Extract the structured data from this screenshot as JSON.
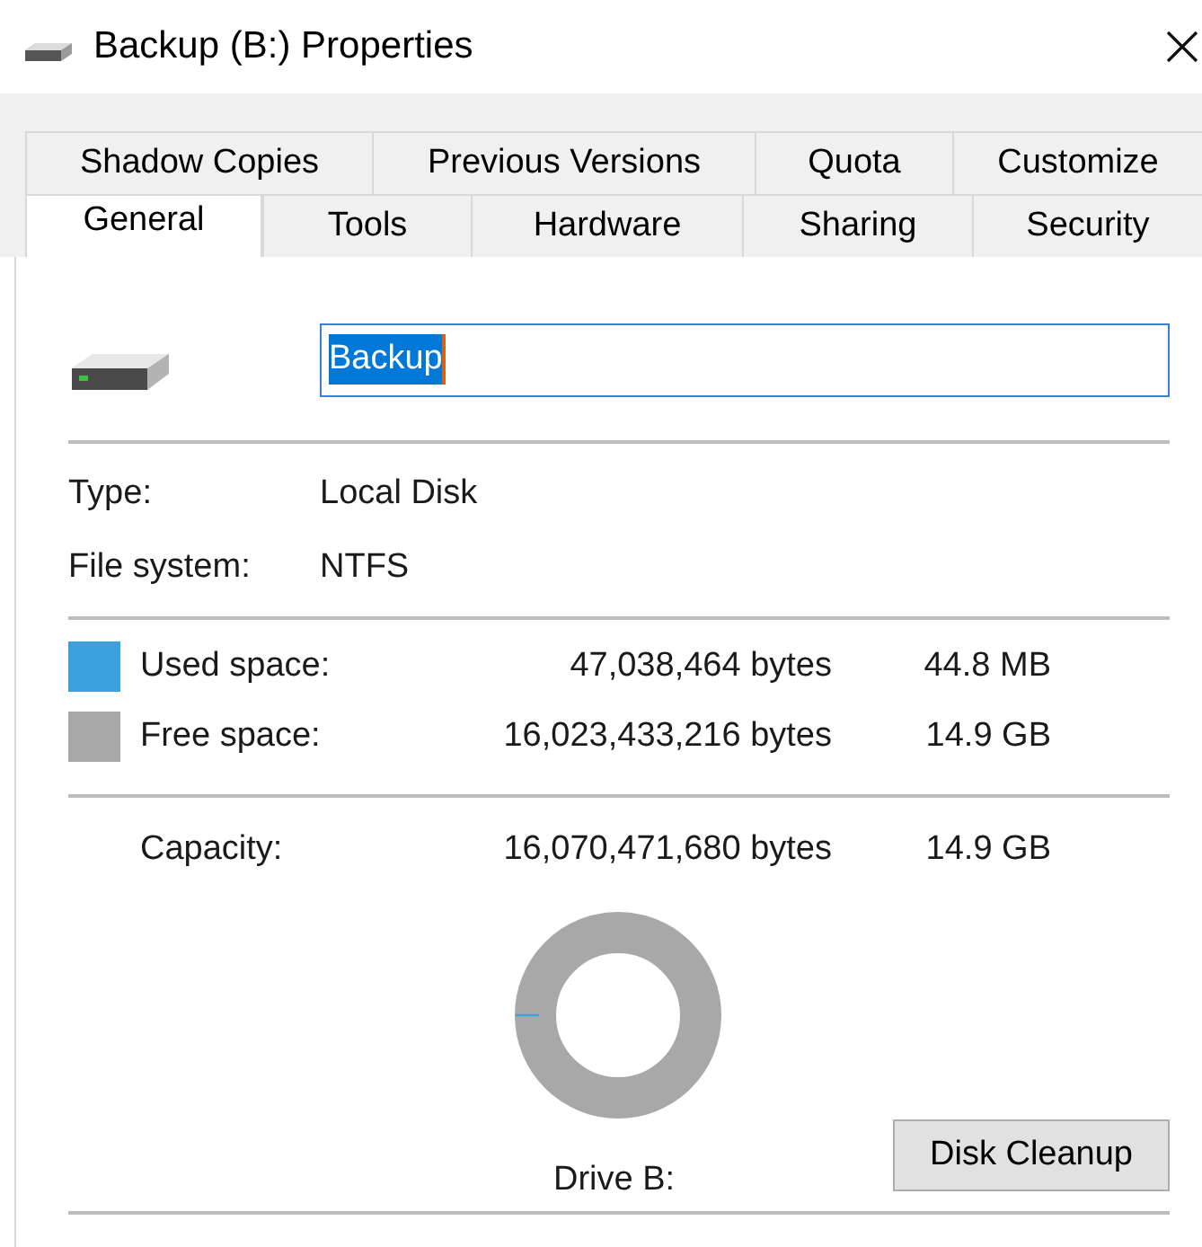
{
  "window": {
    "title": "Backup (B:) Properties"
  },
  "tab_rows": [
    {
      "tabs": [
        {
          "label": "Shadow Copies",
          "selected": false
        },
        {
          "label": "Previous Versions",
          "selected": false
        },
        {
          "label": "Quota",
          "selected": false
        },
        {
          "label": "Customize",
          "selected": false
        }
      ]
    },
    {
      "tabs": [
        {
          "label": "General",
          "selected": true
        },
        {
          "label": "Tools",
          "selected": false
        },
        {
          "label": "Hardware",
          "selected": false
        },
        {
          "label": "Sharing",
          "selected": false
        },
        {
          "label": "Security",
          "selected": false
        }
      ]
    }
  ],
  "name_field": {
    "value": "Backup"
  },
  "info": [
    {
      "label": "Type:",
      "value": "Local Disk"
    },
    {
      "label": "File system:",
      "value": "NTFS"
    }
  ],
  "space": [
    {
      "label": "Used space:",
      "bytes": "47,038,464 bytes",
      "size": "44.8 MB",
      "color": "#3ba1dc"
    },
    {
      "label": "Free space:",
      "bytes": "16,023,433,216 bytes",
      "size": "14.9 GB",
      "color": "#a8a8a8"
    }
  ],
  "capacity": {
    "label": "Capacity:",
    "bytes": "16,070,471,680 bytes",
    "size": "14.9 GB"
  },
  "drive_label": "Drive B:",
  "buttons": [
    "Disk Cleanup"
  ]
}
